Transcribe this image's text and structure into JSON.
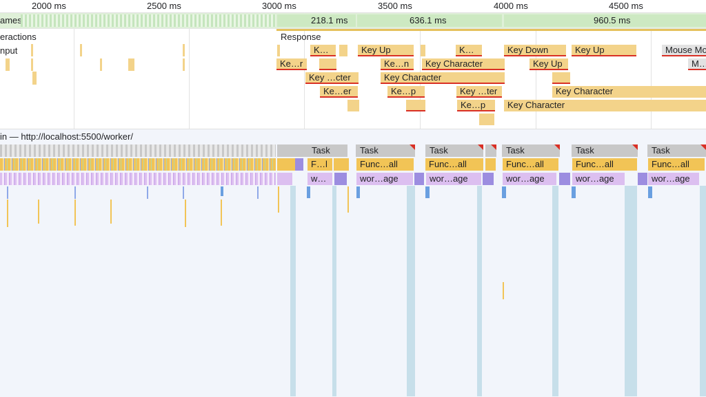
{
  "ruler": {
    "ticks": [
      "2000 ms",
      "2500 ms",
      "3000 ms",
      "3500 ms",
      "4000 ms",
      "4500 ms"
    ]
  },
  "tracks": {
    "frames_label": "ames",
    "interactions_label": "eractions",
    "input_label": "nput",
    "response_label": "Response"
  },
  "frames": {
    "durations": [
      "218.1 ms",
      "636.1 ms",
      "960.5 ms"
    ]
  },
  "input_events": [
    "K…",
    "Key Up",
    "K…",
    "Key Down",
    "Key Up",
    "Mouse Mo",
    "Ke…r",
    "Ke…n",
    "Key Character",
    "Key Up",
    "M…",
    "Key …cter",
    "Key Character",
    "Ke…er",
    "Ke…p",
    "Key …ter",
    "Key Character",
    "Ke…p",
    "Key Character"
  ],
  "worker": {
    "title": "in — http://localhost:5500/worker/",
    "task_label": "Task",
    "func_labels": [
      "F…l",
      "Func…all",
      "Func…all",
      "Func…all",
      "Func…all",
      "Func…all"
    ],
    "worker_labels": [
      "w…",
      "wor…age",
      "wor…age",
      "wor…age",
      "wor…age",
      "wor…age"
    ]
  },
  "colors": {
    "frame_green": "#dff0d8",
    "input_event": "#f3d38a",
    "long_task_marker": "#d93025",
    "function_call": "#f2c456",
    "worker_message": "#dcbff0",
    "gc_blue": "#c7dfea"
  }
}
